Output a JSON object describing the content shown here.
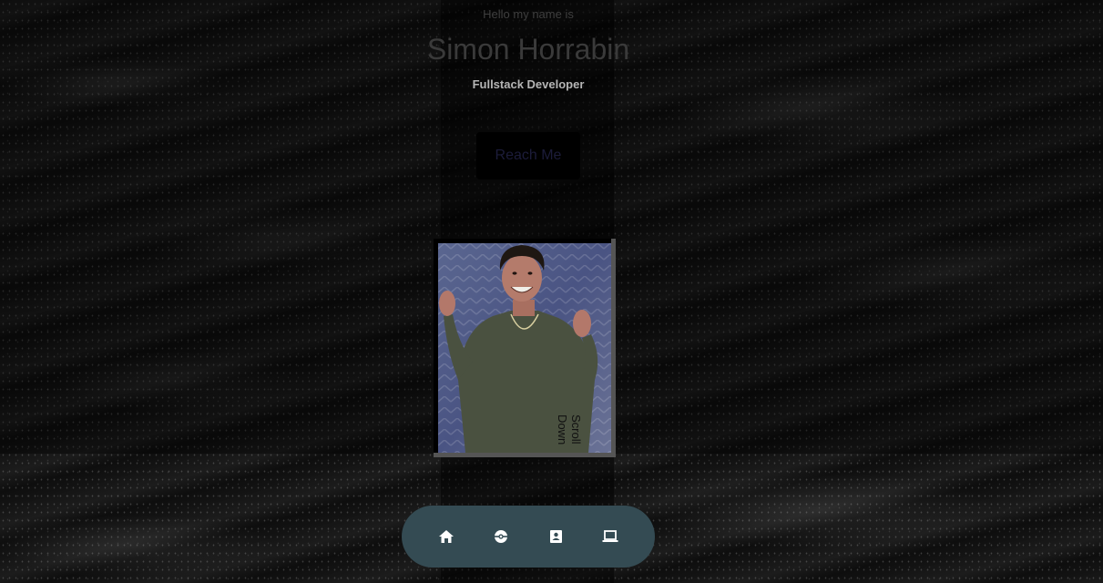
{
  "hero": {
    "greeting": "Hello my name is",
    "name": "Simon Horrabin",
    "role": "Fullstack Developer",
    "cta_label": "Reach Me",
    "scroll_label": "Scroll Down"
  },
  "nav": {
    "items": [
      {
        "icon": "home-icon"
      },
      {
        "icon": "pokeball-icon"
      },
      {
        "icon": "contact-card-icon"
      },
      {
        "icon": "laptop-icon"
      }
    ]
  },
  "colors": {
    "nav_background": "#344b53",
    "icon_color": "#ffffff"
  }
}
